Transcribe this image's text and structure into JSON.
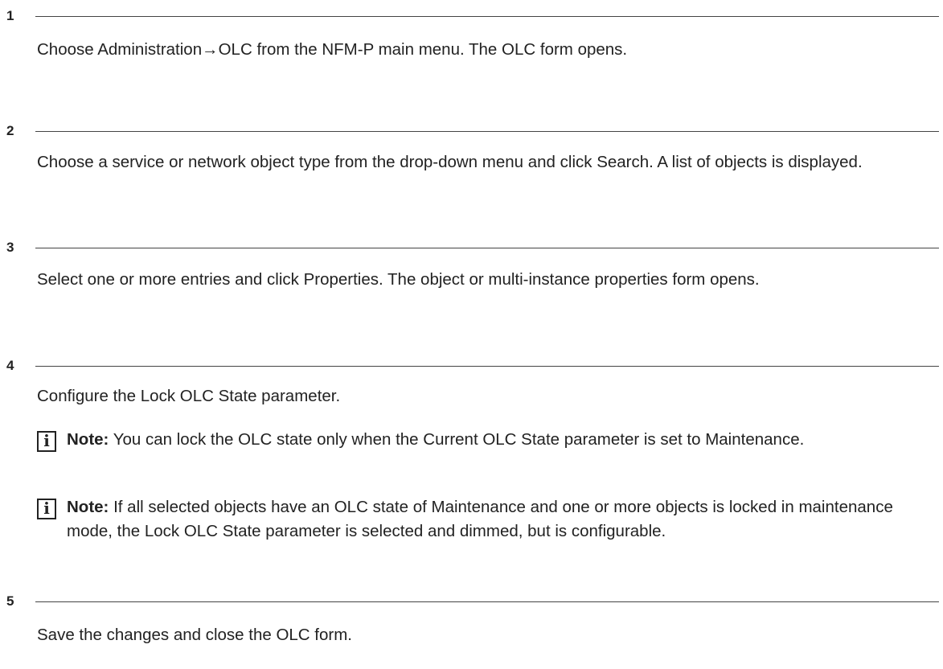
{
  "steps": [
    {
      "number": "1",
      "text": "Choose Administration→OLC from the NFM-P main menu. The OLC form opens."
    },
    {
      "number": "2",
      "text": "Choose a service or network object type from the drop-down menu and click Search. A list of objects is displayed."
    },
    {
      "number": "3",
      "text": "Select one or more entries and click Properties. The object or multi-instance properties form opens."
    },
    {
      "number": "4",
      "text": "Configure the Lock OLC State parameter.",
      "notes": [
        {
          "icon": "info-icon",
          "icon_glyph": "i",
          "label": "Note:",
          "text": " You can lock the OLC state only when the Current OLC State parameter is set to Maintenance."
        },
        {
          "icon": "info-icon",
          "icon_glyph": "i",
          "label": "Note:",
          "text": " If all selected objects have an OLC state of Maintenance and one or more objects is locked in maintenance mode, the Lock OLC State parameter is selected and dimmed, but is configurable."
        }
      ]
    },
    {
      "number": "5",
      "text": "Save the changes and close the OLC form."
    }
  ]
}
